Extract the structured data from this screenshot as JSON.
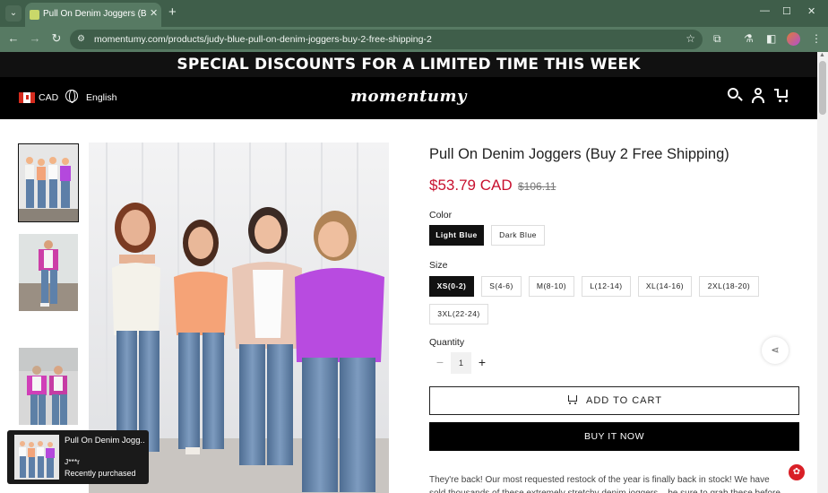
{
  "browser": {
    "tab_title": "Pull On Denim Joggers (Buy 2",
    "url": "momentumy.com/products/judy-blue-pull-on-denim-joggers-buy-2-free-shipping-2",
    "nav_icons": {
      "back": "←",
      "forward": "→",
      "reload": "↻"
    }
  },
  "store": {
    "announcement": "SPECIAL DISCOUNTS FOR A LIMITED TIME THIS WEEK",
    "currency": "CAD",
    "language": "English",
    "logo": "momentumy"
  },
  "product": {
    "title": "Pull On Denim Joggers (Buy 2 Free Shipping)",
    "price": "$53.79 CAD",
    "compare_price": "$106.11",
    "color_label": "Color",
    "colors": [
      "Light Blue",
      "Dark Blue"
    ],
    "size_label": "Size",
    "sizes": [
      "XS(0-2)",
      "S(4-6)",
      "M(8-10)",
      "L(12-14)",
      "XL(14-16)",
      "2XL(18-20)",
      "3XL(22-24)"
    ],
    "quantity_label": "Quantity",
    "quantity": "1",
    "add_to_cart": "ADD TO CART",
    "buy_now": "BUY IT NOW",
    "description": "They're back! Our most requested restock of the year is finally back in stock! We have sold thousands of these extremely stretchy denim joggers... be sure to grab these before they are"
  },
  "popup": {
    "title": "Pull On Denim Jogg...",
    "user": "J***r",
    "status": "Recently purchased"
  },
  "colors": {
    "price_red": "#c8102e",
    "browser_green": "#577a63"
  }
}
